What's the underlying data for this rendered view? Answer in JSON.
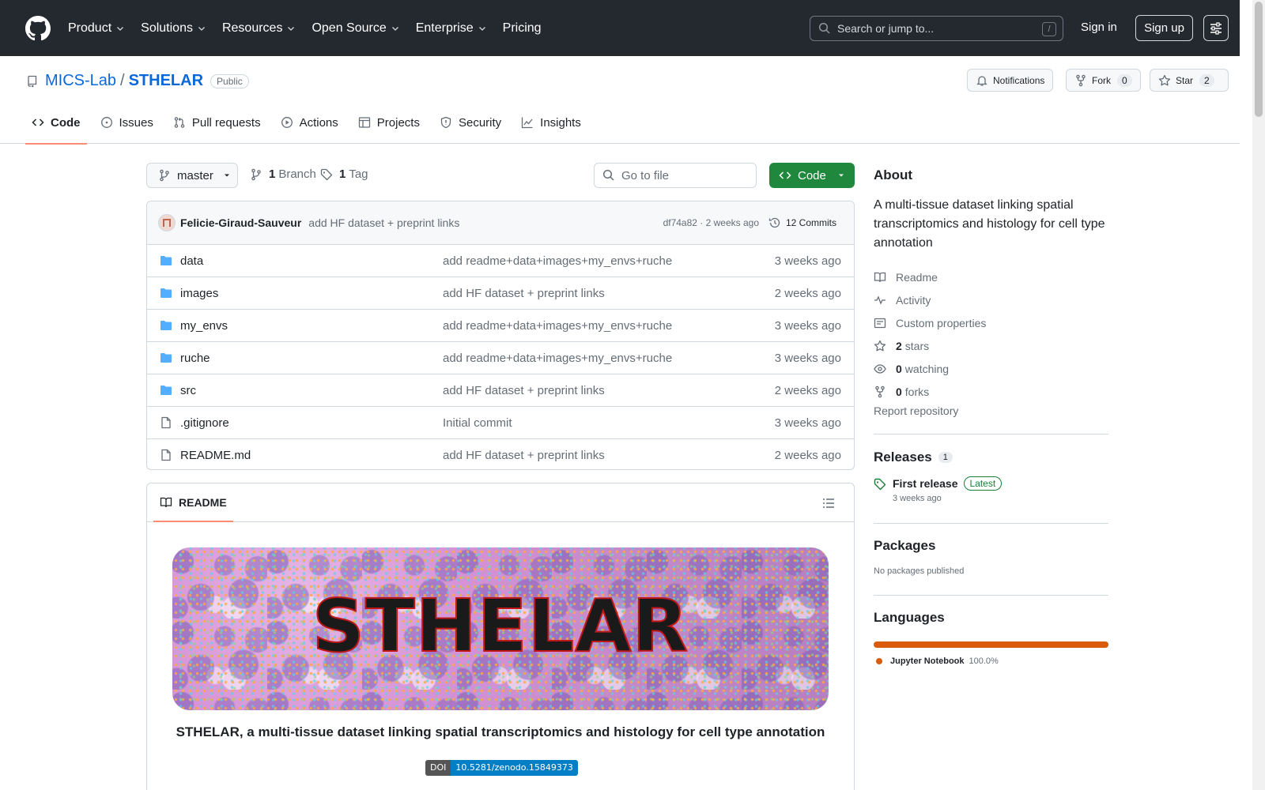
{
  "header": {
    "nav": [
      "Product",
      "Solutions",
      "Resources",
      "Open Source",
      "Enterprise",
      "Pricing"
    ],
    "search_placeholder": "Search or jump to...",
    "search_shortcut": "/",
    "sign_in": "Sign in",
    "sign_up": "Sign up"
  },
  "repo": {
    "owner": "MICS-Lab",
    "separator": "/",
    "name": "STHELAR",
    "visibility": "Public",
    "notifications": "Notifications",
    "fork_label": "Fork",
    "fork_count": "0",
    "star_label": "Star",
    "star_count": "2"
  },
  "tabs": [
    "Code",
    "Issues",
    "Pull requests",
    "Actions",
    "Projects",
    "Security",
    "Insights"
  ],
  "toolbar": {
    "branch": "master",
    "branches_count": "1",
    "branches_label": "Branch",
    "tags_count": "1",
    "tags_label": "Tag",
    "go_to_file": "Go to file",
    "code_button": "Code"
  },
  "commit": {
    "author": "Felicie-Giraud-Sauveur",
    "message": "add HF dataset + preprint links",
    "meta": "df74a82 · 2 weeks ago",
    "commits": "12 Commits"
  },
  "files": [
    {
      "name": "data",
      "type": "folder",
      "message": "add readme+data+images+my_envs+ruche",
      "age": "3 weeks ago"
    },
    {
      "name": "images",
      "type": "folder",
      "message": "add HF dataset + preprint links",
      "age": "2 weeks ago"
    },
    {
      "name": "my_envs",
      "type": "folder",
      "message": "add readme+data+images+my_envs+ruche",
      "age": "3 weeks ago"
    },
    {
      "name": "ruche",
      "type": "folder",
      "message": "add readme+data+images+my_envs+ruche",
      "age": "3 weeks ago"
    },
    {
      "name": "src",
      "type": "folder",
      "message": "add HF dataset + preprint links",
      "age": "2 weeks ago"
    },
    {
      "name": ".gitignore",
      "type": "file",
      "message": "Initial commit",
      "age": "3 weeks ago"
    },
    {
      "name": "README.md",
      "type": "file",
      "message": "add HF dataset + preprint links",
      "age": "2 weeks ago"
    }
  ],
  "readme": {
    "tab": "README",
    "banner_text": "STHELAR",
    "title": "STHELAR, a multi-tissue dataset linking spatial transcriptomics and histology for cell type annotation",
    "doi_label": "DOI",
    "doi_value": "10.5281/zenodo.15849373"
  },
  "about": {
    "heading": "About",
    "description": "A multi-tissue dataset linking spatial transcriptomics and histology for cell type annotation",
    "readme": "Readme",
    "activity": "Activity",
    "custom_properties": "Custom properties",
    "stars_count": "2",
    "stars_label": "stars",
    "watching_count": "0",
    "watching_label": "watching",
    "forks_count": "0",
    "forks_label": "forks",
    "report": "Report repository"
  },
  "releases": {
    "heading": "Releases",
    "count": "1",
    "name": "First release",
    "badge": "Latest",
    "date": "3 weeks ago"
  },
  "packages": {
    "heading": "Packages",
    "empty": "No packages published"
  },
  "languages": {
    "heading": "Languages",
    "items": [
      {
        "name": "Jupyter Notebook",
        "percent": "100.0%",
        "color": "#da5b0b"
      }
    ]
  },
  "colors": {
    "header_bg": "#24292f",
    "link": "#0969da",
    "primary_button": "#1f883d",
    "tab_underline": "#fd8c73"
  }
}
